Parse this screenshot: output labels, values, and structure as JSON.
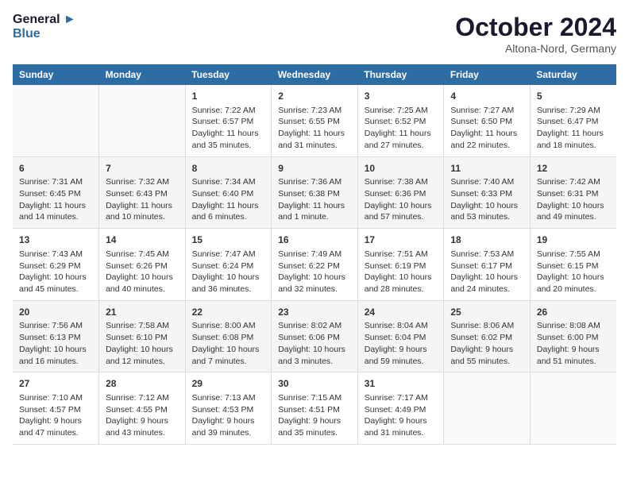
{
  "logo": {
    "line1": "General",
    "line2": "Blue"
  },
  "title": "October 2024",
  "location": "Altona-Nord, Germany",
  "headers": [
    "Sunday",
    "Monday",
    "Tuesday",
    "Wednesday",
    "Thursday",
    "Friday",
    "Saturday"
  ],
  "weeks": [
    [
      {
        "day": "",
        "info": ""
      },
      {
        "day": "",
        "info": ""
      },
      {
        "day": "1",
        "info": "Sunrise: 7:22 AM\nSunset: 6:57 PM\nDaylight: 11 hours and 35 minutes."
      },
      {
        "day": "2",
        "info": "Sunrise: 7:23 AM\nSunset: 6:55 PM\nDaylight: 11 hours and 31 minutes."
      },
      {
        "day": "3",
        "info": "Sunrise: 7:25 AM\nSunset: 6:52 PM\nDaylight: 11 hours and 27 minutes."
      },
      {
        "day": "4",
        "info": "Sunrise: 7:27 AM\nSunset: 6:50 PM\nDaylight: 11 hours and 22 minutes."
      },
      {
        "day": "5",
        "info": "Sunrise: 7:29 AM\nSunset: 6:47 PM\nDaylight: 11 hours and 18 minutes."
      }
    ],
    [
      {
        "day": "6",
        "info": "Sunrise: 7:31 AM\nSunset: 6:45 PM\nDaylight: 11 hours and 14 minutes."
      },
      {
        "day": "7",
        "info": "Sunrise: 7:32 AM\nSunset: 6:43 PM\nDaylight: 11 hours and 10 minutes."
      },
      {
        "day": "8",
        "info": "Sunrise: 7:34 AM\nSunset: 6:40 PM\nDaylight: 11 hours and 6 minutes."
      },
      {
        "day": "9",
        "info": "Sunrise: 7:36 AM\nSunset: 6:38 PM\nDaylight: 11 hours and 1 minute."
      },
      {
        "day": "10",
        "info": "Sunrise: 7:38 AM\nSunset: 6:36 PM\nDaylight: 10 hours and 57 minutes."
      },
      {
        "day": "11",
        "info": "Sunrise: 7:40 AM\nSunset: 6:33 PM\nDaylight: 10 hours and 53 minutes."
      },
      {
        "day": "12",
        "info": "Sunrise: 7:42 AM\nSunset: 6:31 PM\nDaylight: 10 hours and 49 minutes."
      }
    ],
    [
      {
        "day": "13",
        "info": "Sunrise: 7:43 AM\nSunset: 6:29 PM\nDaylight: 10 hours and 45 minutes."
      },
      {
        "day": "14",
        "info": "Sunrise: 7:45 AM\nSunset: 6:26 PM\nDaylight: 10 hours and 40 minutes."
      },
      {
        "day": "15",
        "info": "Sunrise: 7:47 AM\nSunset: 6:24 PM\nDaylight: 10 hours and 36 minutes."
      },
      {
        "day": "16",
        "info": "Sunrise: 7:49 AM\nSunset: 6:22 PM\nDaylight: 10 hours and 32 minutes."
      },
      {
        "day": "17",
        "info": "Sunrise: 7:51 AM\nSunset: 6:19 PM\nDaylight: 10 hours and 28 minutes."
      },
      {
        "day": "18",
        "info": "Sunrise: 7:53 AM\nSunset: 6:17 PM\nDaylight: 10 hours and 24 minutes."
      },
      {
        "day": "19",
        "info": "Sunrise: 7:55 AM\nSunset: 6:15 PM\nDaylight: 10 hours and 20 minutes."
      }
    ],
    [
      {
        "day": "20",
        "info": "Sunrise: 7:56 AM\nSunset: 6:13 PM\nDaylight: 10 hours and 16 minutes."
      },
      {
        "day": "21",
        "info": "Sunrise: 7:58 AM\nSunset: 6:10 PM\nDaylight: 10 hours and 12 minutes."
      },
      {
        "day": "22",
        "info": "Sunrise: 8:00 AM\nSunset: 6:08 PM\nDaylight: 10 hours and 7 minutes."
      },
      {
        "day": "23",
        "info": "Sunrise: 8:02 AM\nSunset: 6:06 PM\nDaylight: 10 hours and 3 minutes."
      },
      {
        "day": "24",
        "info": "Sunrise: 8:04 AM\nSunset: 6:04 PM\nDaylight: 9 hours and 59 minutes."
      },
      {
        "day": "25",
        "info": "Sunrise: 8:06 AM\nSunset: 6:02 PM\nDaylight: 9 hours and 55 minutes."
      },
      {
        "day": "26",
        "info": "Sunrise: 8:08 AM\nSunset: 6:00 PM\nDaylight: 9 hours and 51 minutes."
      }
    ],
    [
      {
        "day": "27",
        "info": "Sunrise: 7:10 AM\nSunset: 4:57 PM\nDaylight: 9 hours and 47 minutes."
      },
      {
        "day": "28",
        "info": "Sunrise: 7:12 AM\nSunset: 4:55 PM\nDaylight: 9 hours and 43 minutes."
      },
      {
        "day": "29",
        "info": "Sunrise: 7:13 AM\nSunset: 4:53 PM\nDaylight: 9 hours and 39 minutes."
      },
      {
        "day": "30",
        "info": "Sunrise: 7:15 AM\nSunset: 4:51 PM\nDaylight: 9 hours and 35 minutes."
      },
      {
        "day": "31",
        "info": "Sunrise: 7:17 AM\nSunset: 4:49 PM\nDaylight: 9 hours and 31 minutes."
      },
      {
        "day": "",
        "info": ""
      },
      {
        "day": "",
        "info": ""
      }
    ]
  ]
}
